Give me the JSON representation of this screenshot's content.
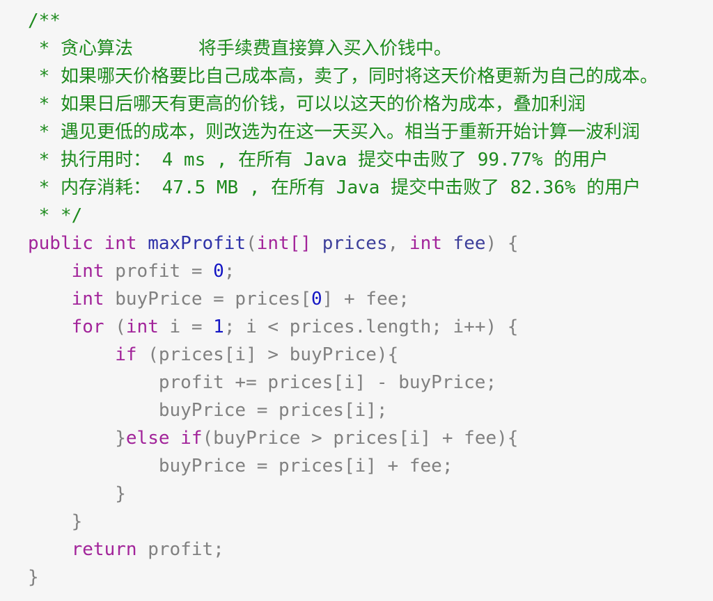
{
  "code": {
    "comment": {
      "open": "/**",
      "l1": " * 贪心算法      将手续费直接算入买入价钱中。",
      "l2": " * 如果哪天价格要比自己成本高，卖了，同时将这天价格更新为自己的成本。",
      "l3": " * 如果日后哪天有更高的价钱，可以以这天的价格为成本，叠加利润",
      "l4": " * 遇见更低的成本，则改选为在这一天买入。相当于重新开始计算一波利润",
      "l5": " * 执行用时： 4 ms , 在所有 Java 提交中击败了 99.77% 的用户",
      "l6": " * 内存消耗： 47.5 MB , 在所有 Java 提交中击败了 82.36% 的用户",
      "close": " * */"
    },
    "sig": {
      "kw_public": "public",
      "kw_int": "int",
      "method": "maxProfit",
      "paren_open": "(",
      "type_arr": "int[]",
      "param1": "prices",
      "comma": ",",
      "type_int": "int",
      "param2": "fee",
      "tail": ") {"
    },
    "l_profit": {
      "indent": "    ",
      "kw": "int",
      "pre": " profit = ",
      "num": "0",
      "post": ";"
    },
    "l_buy": {
      "indent": "    ",
      "kw": "int",
      "pre": " buyPrice = prices[",
      "num": "0",
      "post": "] + fee;"
    },
    "l_for": {
      "indent": "    ",
      "kw_for": "for",
      "mid1": " (",
      "kw_int": "int",
      "mid2": " i = ",
      "num": "1",
      "post": "; i < prices.length; i++) {"
    },
    "l_if": {
      "indent": "        ",
      "kw": "if",
      "post": " (prices[i] > buyPrice){"
    },
    "l_profit_add": "            profit += prices[i] - buyPrice;",
    "l_buy_set": "            buyPrice = prices[i];",
    "l_else": {
      "indent": "        ",
      "brace": "}",
      "kw_else": "else",
      "space": " ",
      "kw_if": "if",
      "post": "(buyPrice > prices[i] + fee){"
    },
    "l_buy_fee": "            buyPrice = prices[i] + fee;",
    "l_close_inner": "        }",
    "l_close_for": "    }",
    "l_return": {
      "indent": "    ",
      "kw": "return",
      "post": " profit;"
    },
    "l_close_method": "}"
  }
}
